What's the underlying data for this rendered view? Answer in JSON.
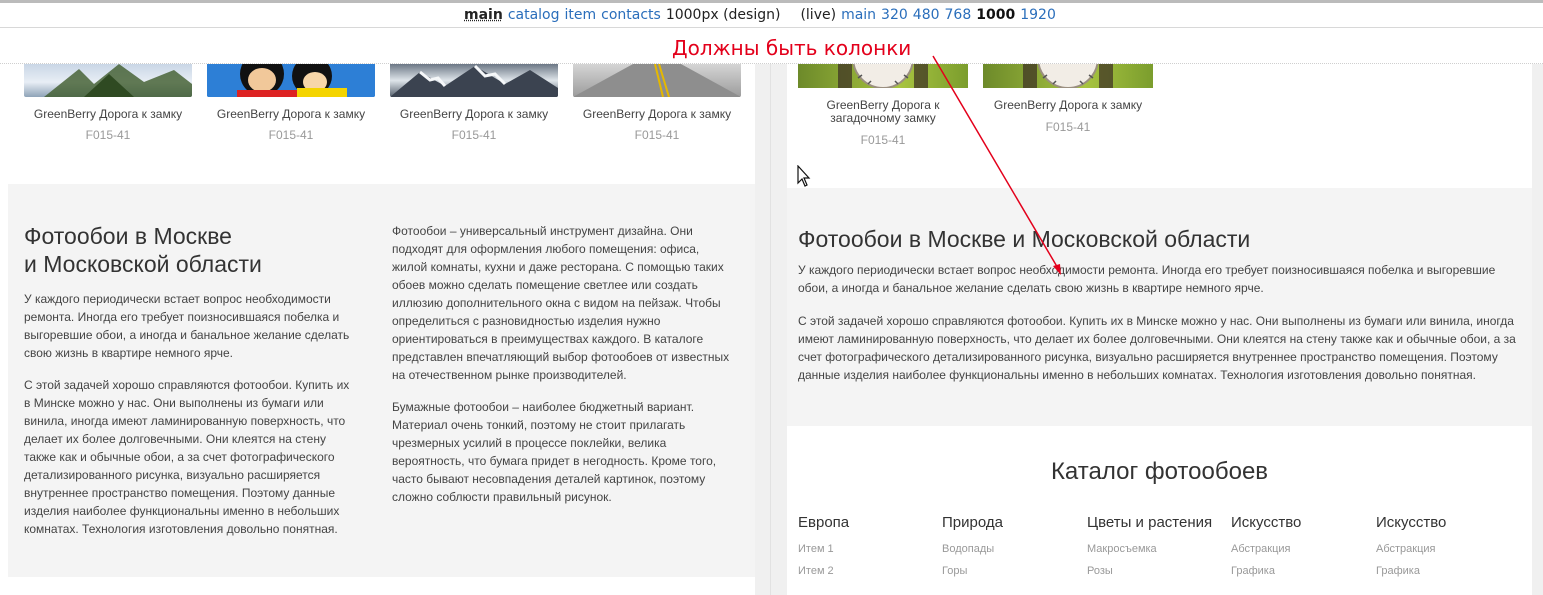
{
  "topbar": {
    "current": "main",
    "links": [
      "catalog",
      "item",
      "contacts"
    ],
    "design_label": "1000px (design)",
    "live_label": "(live)",
    "live_links": [
      "main",
      "320",
      "480",
      "768"
    ],
    "live_current": "1000",
    "live_last": "1920"
  },
  "annotation": {
    "text": "Должны быть колонки",
    "color": "#e3001b"
  },
  "left": {
    "products": [
      {
        "title": "GreenBerry Дорога к замку",
        "code": "F015-41",
        "thumb": "palm"
      },
      {
        "title": "GreenBerry Дорога к замку",
        "code": "F015-41",
        "thumb": "cartoon"
      },
      {
        "title": "GreenBerry Дорога к замку",
        "code": "F015-41",
        "thumb": "snow"
      },
      {
        "title": "GreenBerry Дорога к замку",
        "code": "F015-41",
        "thumb": "road"
      }
    ],
    "heading_line1": "Фотообои в Москве",
    "heading_line2": "и Московской области",
    "col1_p1": "У каждого периодически встает вопрос необходимости ремонта. Иногда его требует поизносившаяся побелка и выгоревшие обои, а иногда и банальное желание сделать свою жизнь в квартире немного ярче.",
    "col1_p2": "С этой задачей хорошо справляются фотообои. Купить их в Минске можно у нас. Они выполнены из бумаги или винила, иногда имеют ламинированную поверхность, что делает их более долговечными. Они клеятся на стену также как и обычные обои, а за счет фотографического детализированного рисунка, визуально расширяется внутреннее пространство помещения. Поэтому данные изделия наиболее функциональны именно в небольших комнатах. Технология изготовления довольно понятная.",
    "col2_p1": "Фотообои – универсальный инструмент дизайна. Они подходят для оформления любого помещения: офиса, жилой комнаты, кухни и даже ресторана. С помощью таких обоев можно сделать помещение светлее или создать иллюзию дополнительного окна с видом на пейзаж. Чтобы определиться с разновидностью изделия нужно ориентироваться в преимуществах каждого. В каталоге представлен впечатляющий выбор фотообоев от известных на отечественном рынке производителей.",
    "col2_p2": "Бумажные фотообои – наиболее бюджетный вариант. Материал очень тонкий, поэтому не стоит прилагать чрезмерных усилий в процессе поклейки, велика вероятность, что бумага придет в негодность. Кроме того, часто бывают несовпадения деталей картинок, поэтому сложно соблюсти правильный рисунок."
  },
  "right": {
    "products": [
      {
        "title": "GreenBerry Дорога к загадочному замку",
        "code": "F015-41"
      },
      {
        "title": "GreenBerry Дорога к замку",
        "code": "F015-41"
      }
    ],
    "heading": "Фотообои в Москве и Московской области",
    "p1": "У каждого периодически встает вопрос необходимости ремонта. Иногда его требует поизносившаяся побелка и выгоревшие обои, а иногда и банальное желание сделать свою жизнь в квартире немного ярче.",
    "p2": "С этой задачей хорошо справляются фотообои. Купить их в Минске можно у нас. Они выполнены из бумаги или винила, иногда имеют ламинированную поверхность, что делает их более долговечными. Они клеятся на стену также как и обычные обои, а за счет фотографического детализированного рисунка, визуально расширяется внутреннее пространство помещения. Поэтому данные изделия наиболее функциональны именно в небольших комнатах. Технология изготовления довольно понятная.",
    "catalog_title": "Каталог фотообоев",
    "catalog": [
      {
        "name": "Европа",
        "items": [
          "Итем 1",
          "Итем 2"
        ]
      },
      {
        "name": "Природа",
        "items": [
          "Водопады",
          "Горы"
        ]
      },
      {
        "name": "Цветы и растения",
        "items": [
          "Макросъемка",
          "Розы"
        ]
      },
      {
        "name": "Искусство",
        "items": [
          "Абстракция",
          "Графика"
        ]
      },
      {
        "name": "Искусство",
        "items": [
          "Абстракция",
          "Графика"
        ]
      }
    ]
  }
}
